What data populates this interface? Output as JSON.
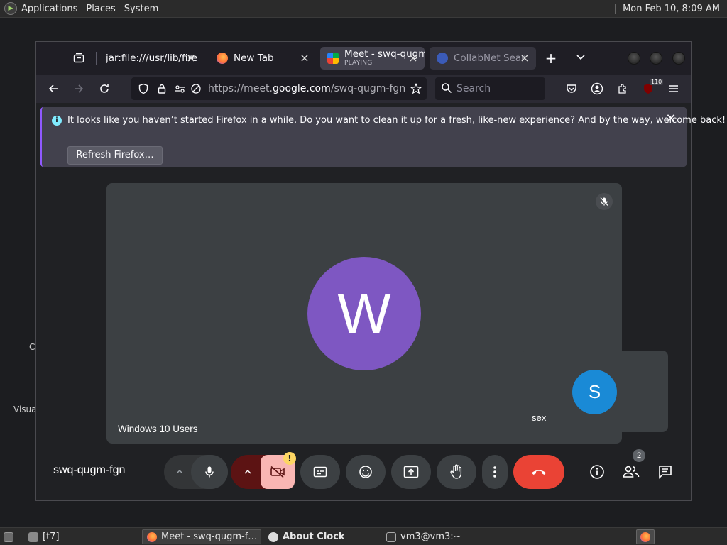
{
  "top_panel": {
    "menus": [
      "Applications",
      "Places",
      "System"
    ],
    "clock": "Mon Feb 10,  8:09 AM"
  },
  "desktop": {
    "fragments": [
      "C",
      "Visua"
    ]
  },
  "browser": {
    "tabs": [
      {
        "title": "jar:file:///usr/lib/fire",
        "subtitle": "",
        "icon": "file-icon",
        "active": false
      },
      {
        "title": "New Tab",
        "subtitle": "",
        "icon": "firefox-icon",
        "active": false
      },
      {
        "title": "Meet - swq-qugm",
        "subtitle": "PLAYING",
        "icon": "google-meet-icon",
        "active": true
      },
      {
        "title": "CollabNet Sear",
        "subtitle": "",
        "icon": "collabnet-icon",
        "active": false
      }
    ],
    "url_prefix": "https://meet.",
    "url_domain": "google.com",
    "url_path": "/swq-qugm-fgn",
    "search_placeholder": "Search",
    "extensions_badge": "110",
    "notification": {
      "message": "It looks like you haven’t started Firefox in a while. Do you want to clean it up for a fresh, like-new experience? And by the way, welcome back!",
      "button": "Refresh Firefox…"
    }
  },
  "meet": {
    "main_participant": {
      "initial": "W",
      "name": "Windows 10 Users",
      "avatar_color": "#7e57c2"
    },
    "self_participant": {
      "initial": "S",
      "name": "sex",
      "avatar_color": "#1a8ad6"
    },
    "meeting_code": "swq-qugm-fgn",
    "people_count": "2",
    "camera_warning": "!",
    "end_call_color": "#ea4335"
  },
  "taskbar": {
    "items": [
      {
        "label": "[t7]",
        "icon": "folder-icon"
      },
      {
        "label": "Meet - swq-qugm-f…",
        "icon": "firefox-icon",
        "active": true
      },
      {
        "label": "About Clock",
        "icon": "clock-icon",
        "bold": true
      },
      {
        "label": "vm3@vm3:~",
        "icon": "terminal-icon"
      }
    ]
  }
}
